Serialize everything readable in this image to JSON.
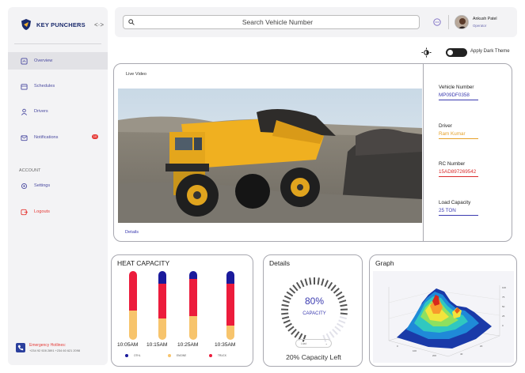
{
  "brand": {
    "name": "KEY PUNCHERS"
  },
  "sidebar": {
    "items": [
      {
        "label": "Overview",
        "icon": "overview-icon",
        "active": true
      },
      {
        "label": "Schedules",
        "icon": "calendar-icon",
        "active": false
      },
      {
        "label": "Drivers",
        "icon": "person-icon",
        "active": false
      },
      {
        "label": "Notifications",
        "icon": "mail-icon",
        "active": false,
        "badge": "10"
      }
    ],
    "section_label": "ACCOUNT",
    "account_items": [
      {
        "label": "Settings",
        "icon": "settings-icon"
      },
      {
        "label": "Logouts",
        "icon": "logout-icon"
      }
    ],
    "hotline": {
      "title": "Emergency Hotlines:",
      "numbers": "+234 92 928 2891     +234 60 621 2098"
    }
  },
  "header": {
    "search_placeholder": "Search Vehicle Number",
    "user": {
      "name": "Ankush Patel",
      "role": "Operator"
    }
  },
  "theme": {
    "label": "Apply Dark Theme",
    "dark_enabled": false
  },
  "video": {
    "title": "Live Video",
    "details_link": "Details"
  },
  "vehicle_info": [
    {
      "label": "Vehicle Number",
      "value": "MP09DF0358"
    },
    {
      "label": "Driver",
      "value": "Ram Kumar"
    },
    {
      "label": "RC Number",
      "value": "15AD897269542"
    },
    {
      "label": "Load Capacity",
      "value": "25 TON"
    }
  ],
  "heat": {
    "title": "HEAT CAPACITY",
    "colors": {
      "blue": "#1a1a9c",
      "red": "#ec1c3c",
      "yellow": "#f7c46c"
    },
    "legend": [
      "OTHL",
      "ENGINE",
      "TRUCK"
    ]
  },
  "details_panel": {
    "title": "Details",
    "percent": "80%",
    "caption": "CAPACITY",
    "percent_value": 0.8,
    "dropdown": "Load",
    "capacity_left": "20% Capacity Left"
  },
  "graph": {
    "title": "Graph"
  },
  "chart_data": {
    "type": "bar",
    "title": "HEAT CAPACITY",
    "categories": [
      "10:05AM",
      "10:15AM",
      "10:25AM",
      "10:35AM"
    ],
    "series": [
      {
        "name": "OTHL",
        "values": [
          0,
          18,
          12,
          18
        ]
      },
      {
        "name": "ENGINE",
        "values": [
          42,
          31,
          34,
          21
        ]
      },
      {
        "name": "TRUCK",
        "values": [
          58,
          51,
          54,
          61
        ]
      }
    ],
    "stacked": true,
    "colors": [
      "#1a1a9c",
      "#f7c46c",
      "#ec1c3c"
    ]
  }
}
